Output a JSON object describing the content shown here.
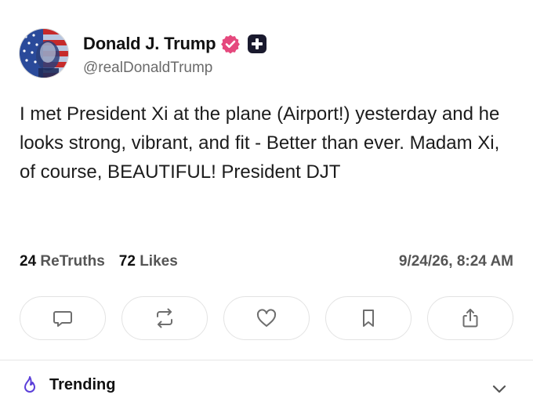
{
  "author": {
    "name": "Donald J. Trump",
    "handle": "@realDonaldTrump",
    "avatar_icon": "flag-portrait-avatar",
    "verified_icon": "verified-badge-icon",
    "plus_icon": "plus-badge-icon"
  },
  "post": {
    "text": "I met President Xi at the plane (Airport!) yesterday and he looks strong, vibrant, and fit - Better than ever. Madam Xi, of course, BEAUTIFUL! President DJT"
  },
  "stats": {
    "retruths_count": "24",
    "retruths_label": "ReTruths",
    "likes_count": "72",
    "likes_label": "Likes",
    "timestamp": "9/24/26, 8:24 AM"
  },
  "actions": [
    {
      "icon": "reply-icon"
    },
    {
      "icon": "retruth-icon"
    },
    {
      "icon": "like-icon"
    },
    {
      "icon": "bookmark-icon"
    },
    {
      "icon": "share-icon"
    }
  ],
  "trending": {
    "label": "Trending",
    "icon": "flame-icon",
    "chevron_icon": "chevron-down-icon"
  },
  "colors": {
    "verified": "#E5487D",
    "plus_badge": "#1A1A2E",
    "trending_icon": "#5B3FD9",
    "action_icon": "#6E6E6E",
    "muted_text": "#6B6B6B"
  }
}
